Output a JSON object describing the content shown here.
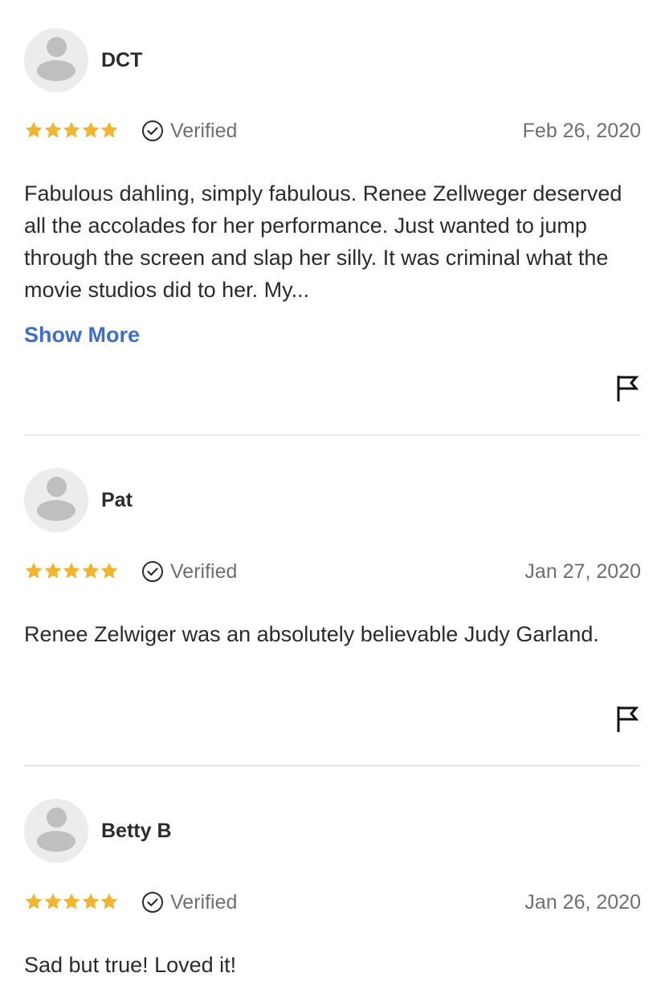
{
  "reviews": [
    {
      "author": "DCT",
      "rating": 5,
      "verified_label": "Verified",
      "date": "Feb 26, 2020",
      "text": "Fabulous dahling, simply fabulous. Renee Zellweger deserved all the accolades for her performance. Just wanted to jump through the screen and slap her silly. It was criminal what the movie studios did to her. My...",
      "show_more_label": "Show More"
    },
    {
      "author": "Pat",
      "rating": 5,
      "verified_label": "Verified",
      "date": "Jan 27, 2020",
      "text": "Renee Zelwiger was an absolutely believable Judy Garland."
    },
    {
      "author": "Betty B",
      "rating": 5,
      "verified_label": "Verified",
      "date": "Jan 26, 2020",
      "text": "Sad but true! Loved it!"
    }
  ],
  "colors": {
    "star": "#f2b531",
    "link": "#3f6fca",
    "meta_text": "#6f6f6f",
    "divider": "#e9e9e9"
  },
  "icons": {
    "avatar": "user-avatar-icon",
    "star": "star-icon",
    "verified": "check-circle-icon",
    "flag": "flag-icon"
  }
}
